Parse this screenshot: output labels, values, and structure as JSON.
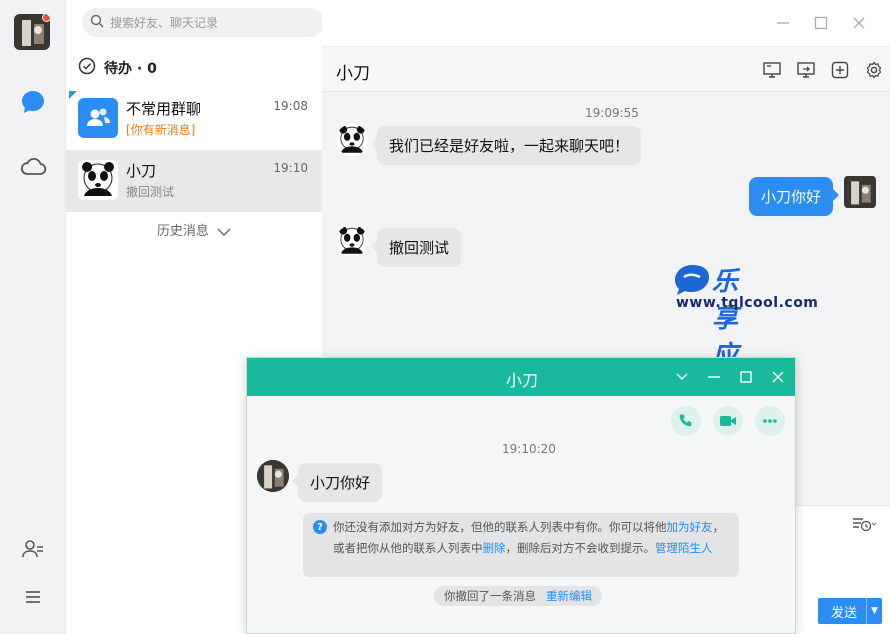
{
  "search": {
    "placeholder": "搜索好友、聊天记录"
  },
  "todo": {
    "label": "待办 · 0"
  },
  "conversations": [
    {
      "name": "不常用群聊",
      "preview": "[你有新消息]",
      "time": "19:08"
    },
    {
      "name": "小刀",
      "preview": "撤回测试",
      "time": "19:10"
    }
  ],
  "history_label": "历史消息",
  "chat": {
    "title": "小刀",
    "timestamp": "19:09:55",
    "messages": [
      {
        "side": "left",
        "text": "我们已经是好友啦，一起来聊天吧！"
      },
      {
        "side": "right",
        "text": "小刀你好"
      },
      {
        "side": "left",
        "text": "撤回测试"
      }
    ],
    "send_label": "发送"
  },
  "watermark": {
    "brand": "乐享应用",
    "url": "www.tqlcool.com"
  },
  "popup": {
    "title": "小刀",
    "timestamp": "19:10:20",
    "message": "小刀你好",
    "notice": {
      "part1": "你还没有添加对方为好友，但他的联系人列表中有你。你可以将他",
      "link1": "加为好友",
      "part2": "，或者把你从他的联系人列表中",
      "link2": "删除",
      "part3": "，删除后对方不会收到提示。",
      "link3": "管理陌生人"
    },
    "recall": {
      "text": "你撤回了一条消息",
      "link": "重新编辑"
    }
  },
  "colors": {
    "accent": "#2b8cf2",
    "popup_title": "#19b99c",
    "warn": "#f07a1a"
  }
}
